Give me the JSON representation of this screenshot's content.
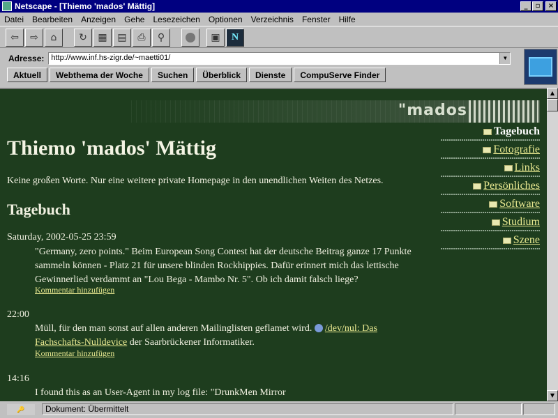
{
  "window": {
    "title": "Netscape - [Thiemo 'mados' Mättig]",
    "buttons": {
      "minimize": "_",
      "maximize": "▫",
      "close": "×"
    }
  },
  "menu": [
    "Datei",
    "Bearbeiten",
    "Anzeigen",
    "Gehe",
    "Lesezeichen",
    "Optionen",
    "Verzeichnis",
    "Fenster",
    "Hilfe"
  ],
  "toolbar": {
    "icons": [
      "back-icon",
      "forward-icon",
      "home-icon",
      "reload-icon",
      "images-icon",
      "open-icon",
      "print-icon",
      "find-icon",
      "stop-icon",
      "network-icon",
      "netscape-logo-icon"
    ]
  },
  "address": {
    "label": "Adresse:",
    "value": "http://www.inf.hs-zigr.de/~maetti01/"
  },
  "directory_buttons": [
    "Aktuell",
    "Webthema der Woche",
    "Suchen",
    "Überblick",
    "Dienste",
    "CompuServe Finder"
  ],
  "page": {
    "logo_text": "\"mados",
    "heading": "Thiemo 'mados' Mättig",
    "intro": "Keine großen Worte. Nur eine weitere private Homepage in den unendlichen Weiten des Netzes.",
    "section": "Tagebuch",
    "entries": [
      {
        "date": "Saturday, 2002-05-25 23:59",
        "text": "\"Germany, zero points.\" Beim European Song Contest hat der deutsche Beitrag ganze 17 Punkte sammeln können - Platz 21 für unsere blinden Rockhippies. Dafür erinnert mich das lettische Gewinnerlied verdammt an \"Lou Bega - Mambo Nr. 5\". Ob ich damit falsch liege?",
        "comment": "Kommentar hinzufügen"
      },
      {
        "date": "22:00",
        "text_before": "Müll, für den man sonst auf allen anderen Mailinglisten geflamet wird.",
        "link": "/dev/nul: Das Fachschafts-Nulldevice",
        "text_after": "der Saarbrückener Informatiker.",
        "comment": "Kommentar hinzufügen"
      },
      {
        "date": "14:16",
        "text": "I found this as an User-Agent in my log file: \"DrunkMen Mirror"
      }
    ],
    "nav": [
      {
        "label": "Tagebuch",
        "current": true
      },
      {
        "label": "Fotografie",
        "current": false
      },
      {
        "label": "Links",
        "current": false
      },
      {
        "label": "Persönliches",
        "current": false
      },
      {
        "label": "Software",
        "current": false
      },
      {
        "label": "Studium",
        "current": false
      },
      {
        "label": "Szene",
        "current": false
      }
    ]
  },
  "status": {
    "text": "Dokument: Übermittelt"
  },
  "colors": {
    "page_background": "#1e3d1e",
    "link": "#e8e890",
    "title_bar": "#000080"
  }
}
